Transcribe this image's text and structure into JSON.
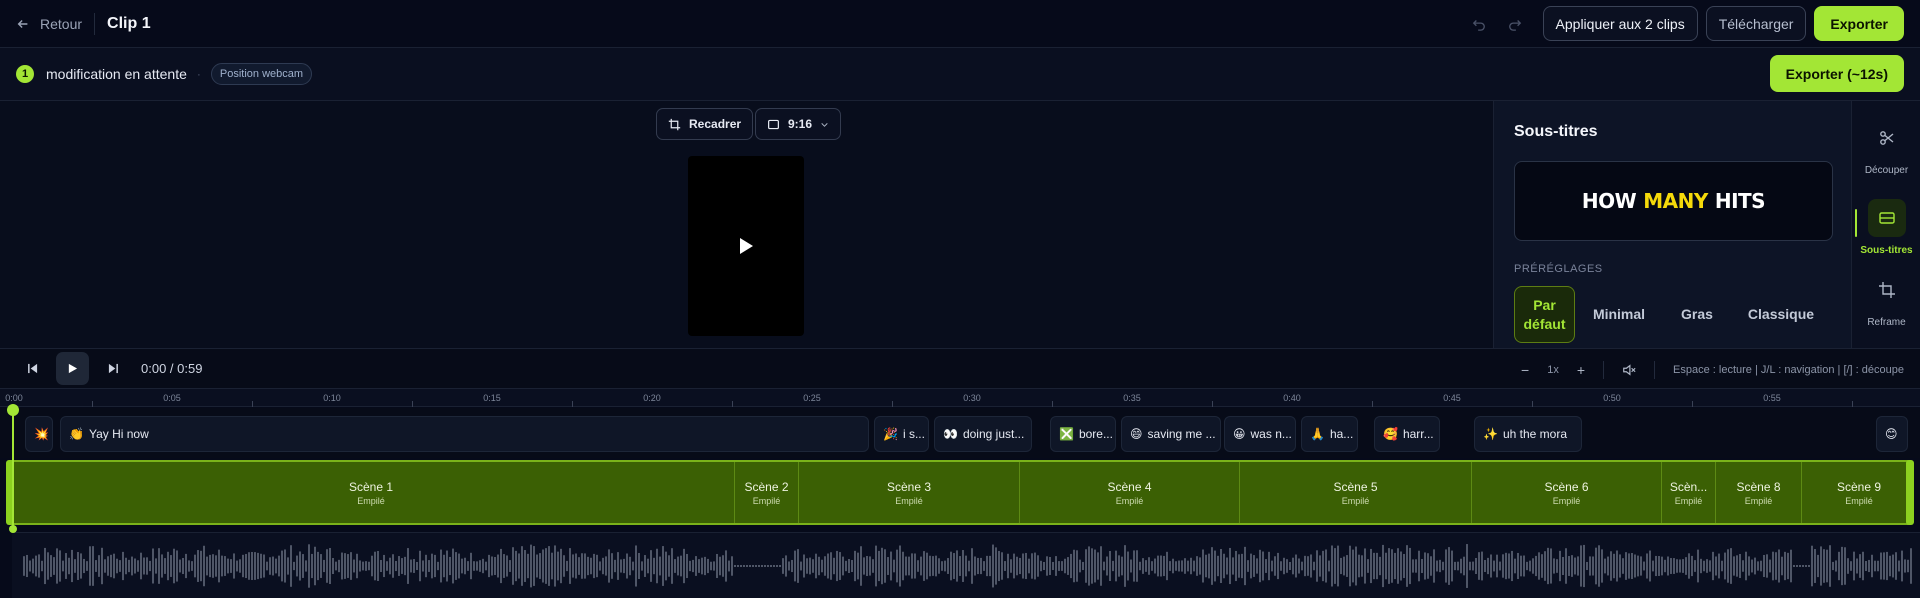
{
  "header": {
    "back_label": "Retour",
    "clip_title": "Clip 1",
    "apply_label": "Appliquer aux 2 clips",
    "download_label": "Télécharger",
    "export_label": "Exporter"
  },
  "pending": {
    "count": "1",
    "text": "modification en attente",
    "separator": "·",
    "chip": "Position webcam",
    "export_label": "Exporter (~12s)"
  },
  "preview": {
    "reframe_label": "Recadrer",
    "aspect_label": "9:16"
  },
  "subtitles": {
    "title": "Sous-titres",
    "preview_words": [
      "HOW",
      "MANY",
      "HITS"
    ],
    "presets_label": "PRÉRÉGLAGES",
    "presets": [
      {
        "label": "Par défaut",
        "active": true
      },
      {
        "label": "Minimal",
        "active": false
      },
      {
        "label": "Gras",
        "active": false
      },
      {
        "label": "Classique",
        "active": false
      }
    ]
  },
  "rail": [
    {
      "label": "Découper",
      "icon": "scissors-icon"
    },
    {
      "label": "Sous-titres",
      "icon": "subtitles-icon"
    },
    {
      "label": "Reframe",
      "icon": "crop-icon"
    }
  ],
  "transport": {
    "time": "0:00 / 0:59",
    "minus": "−",
    "speed": "1x",
    "plus": "+",
    "shortcuts": "Espace : lecture | J/L : navigation | [/] : découpe"
  },
  "ruler": [
    "0:00",
    "0:05",
    "0:10",
    "0:15",
    "0:20",
    "0:25",
    "0:30",
    "0:35",
    "0:40",
    "0:45",
    "0:50",
    "0:55"
  ],
  "captions": [
    {
      "emoji": "💥",
      "text": ""
    },
    {
      "emoji": "👏",
      "text": "Yay Hi now"
    },
    {
      "emoji": "🎉",
      "text": "i s..."
    },
    {
      "emoji": "👀",
      "text": "doing just..."
    },
    {
      "emoji": "❎",
      "text": "bore..."
    },
    {
      "emoji": "😄",
      "text": "saving me ..."
    },
    {
      "emoji": "😀",
      "text": "was n..."
    },
    {
      "emoji": "🙏",
      "text": "ha..."
    },
    {
      "emoji": "🥰",
      "text": "harr..."
    },
    {
      "emoji": "✨",
      "text": "uh the mora"
    },
    {
      "emoji": "😊",
      "text": ""
    }
  ],
  "scenes": [
    {
      "name": "Scène 1",
      "sub": "Empilé"
    },
    {
      "name": "Scène 2",
      "sub": "Empilé"
    },
    {
      "name": "Scène 3",
      "sub": "Empilé"
    },
    {
      "name": "Scène 4",
      "sub": "Empilé"
    },
    {
      "name": "Scène 5",
      "sub": "Empilé"
    },
    {
      "name": "Scène 6",
      "sub": "Empilé"
    },
    {
      "name": "Scèn...",
      "sub": "Empilé"
    },
    {
      "name": "Scène 8",
      "sub": "Empilé"
    },
    {
      "name": "Scène 9",
      "sub": "Empilé"
    }
  ],
  "colors": {
    "accent": "#a3e635",
    "background": "#060a1a",
    "scene_fill": "#3b6004",
    "subtitle_highlight": "#f5d90a"
  }
}
